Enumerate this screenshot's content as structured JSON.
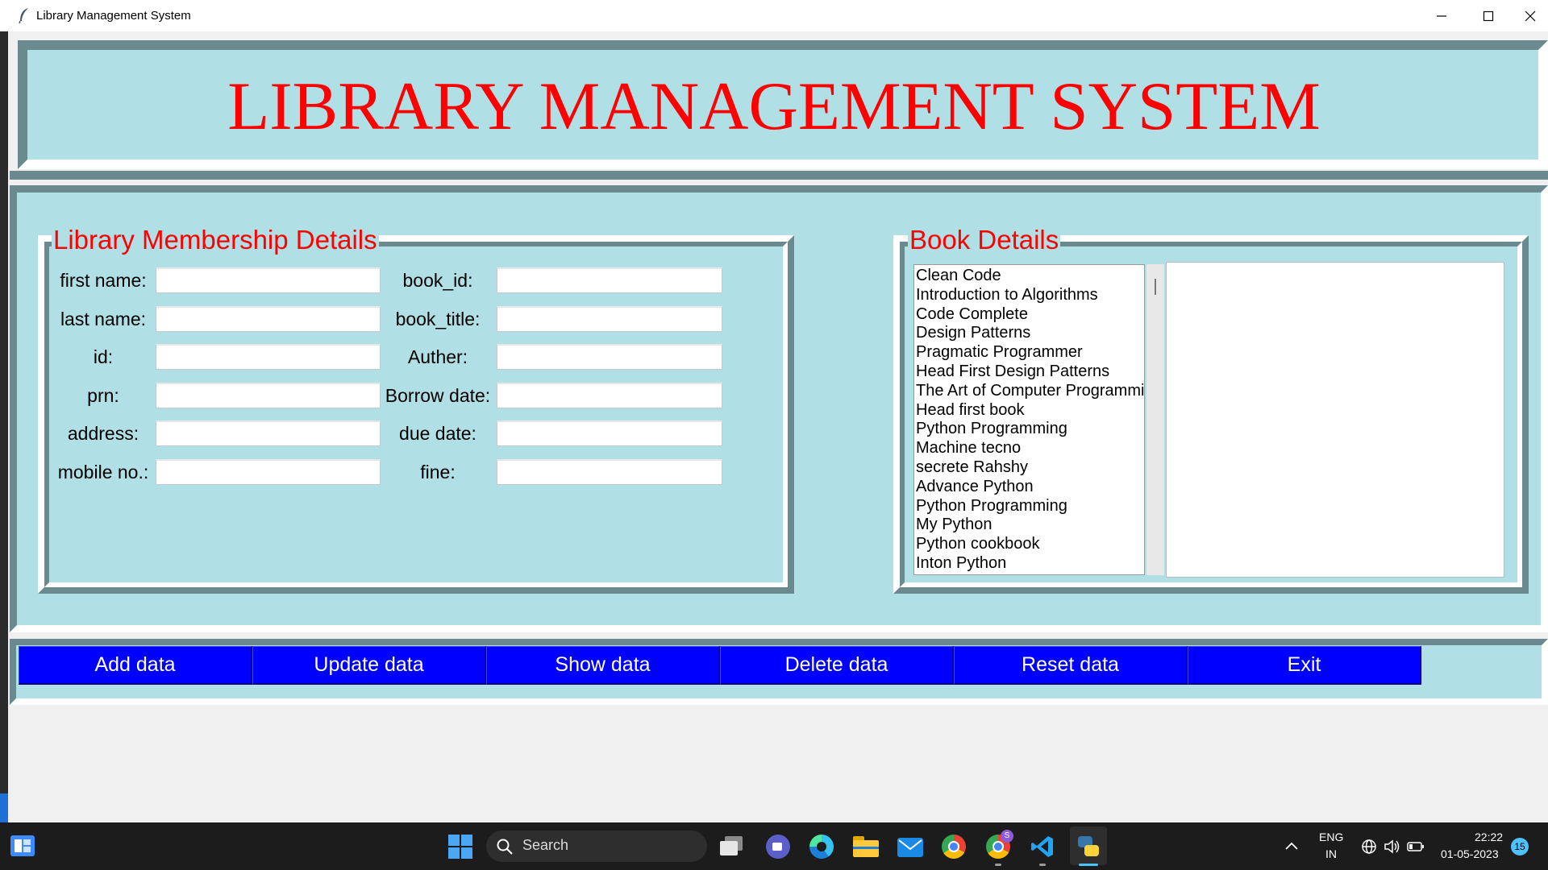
{
  "window": {
    "title": "Library Management System",
    "controls": [
      "minimize",
      "maximize",
      "close"
    ]
  },
  "header": {
    "title": "LIBRARY MANAGEMENT SYSTEM"
  },
  "membership": {
    "legend": "Library Membership Details",
    "left_fields": [
      {
        "label": "first name:",
        "value": ""
      },
      {
        "label": "last name:",
        "value": ""
      },
      {
        "label": "id:",
        "value": ""
      },
      {
        "label": "prn:",
        "value": ""
      },
      {
        "label": "address:",
        "value": ""
      },
      {
        "label": "mobile no.:",
        "value": ""
      }
    ],
    "right_fields": [
      {
        "label": "book_id:",
        "value": ""
      },
      {
        "label": "book_title:",
        "value": ""
      },
      {
        "label": "Auther:",
        "value": ""
      },
      {
        "label": "Borrow date:",
        "value": ""
      },
      {
        "label": "due date:",
        "value": ""
      },
      {
        "label": "fine:",
        "value": ""
      }
    ]
  },
  "books": {
    "legend": "Book Details",
    "items": [
      "Clean Code",
      "Introduction to Algorithms",
      "Code Complete",
      "Design Patterns",
      "Pragmatic Programmer",
      "Head First Design Patterns",
      "The Art of Computer Programmir",
      "Head first book",
      "Python Programming",
      "Machine tecno",
      "secrete Rahshy",
      "Advance Python",
      "Python Programming",
      "My Python",
      "Python cookbook",
      "Inton Python"
    ],
    "details_text": ""
  },
  "buttons": [
    "Add data",
    "Update data",
    "Show data",
    "Delete data",
    "Reset data",
    "Exit"
  ],
  "taskbar": {
    "search_label": "Search",
    "language": "ENG",
    "region": "IN",
    "time": "22:22",
    "date": "01-05-2023",
    "notification_count": "15",
    "chrome_badge": "S",
    "icons": [
      "start-icon",
      "search-icon",
      "task-view-icon",
      "teams-icon",
      "edge-icon",
      "file-explorer-icon",
      "mail-icon",
      "chrome-icon",
      "chrome-profile-icon",
      "vscode-icon",
      "python-icon",
      "chevron-up-icon",
      "network-icon",
      "volume-icon",
      "battery-icon"
    ]
  },
  "colors": {
    "frame_bg": "#b0dfe5",
    "frame_dark": "#6a8a90",
    "title_red": "#ff0000",
    "button_blue": "#0000ff",
    "taskbar": "#1c1c1c"
  }
}
